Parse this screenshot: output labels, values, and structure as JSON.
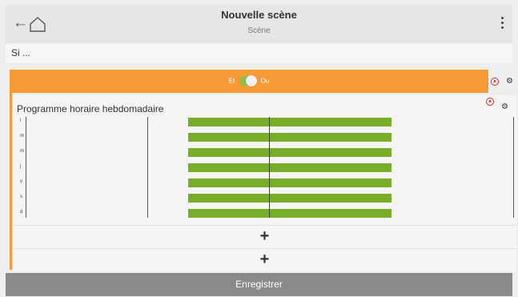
{
  "header": {
    "back_glyph": "←",
    "title": "Nouvelle scène",
    "subtitle": "Scène",
    "icons": [
      "arrow-left-icon",
      "home-icon",
      "more-vertical-icon"
    ]
  },
  "condition": {
    "label": "Si ..."
  },
  "logic": {
    "left_label": "Et",
    "right_label": "Ou",
    "toggle_state": "Ou"
  },
  "schedule": {
    "title": "Programme horaire hebdomadaire",
    "days": [
      "l",
      "m",
      "m",
      "j",
      "v",
      "s",
      "d"
    ]
  },
  "add_rows": [
    "+",
    "+"
  ],
  "footer": {
    "save_label": "Enregistrer"
  },
  "colors": {
    "accent": "#f79a35",
    "bar": "#78ad2a",
    "toggle": "#88c247",
    "delete": "#e02020"
  }
}
